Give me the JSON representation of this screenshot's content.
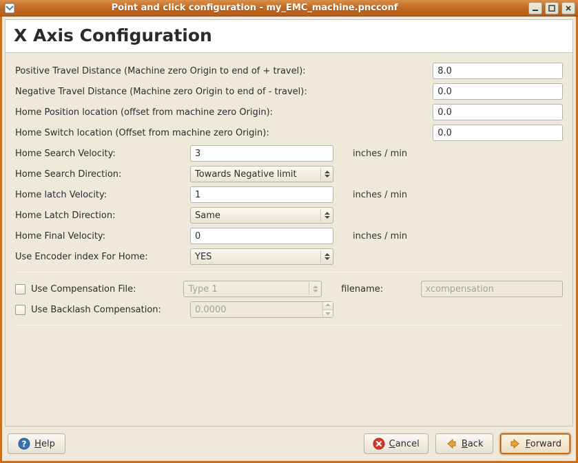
{
  "window": {
    "title": "Point and click configuration - my_EMC_machine.pncconf"
  },
  "page": {
    "title": "X Axis Configuration"
  },
  "fields": {
    "pos_travel_label": "Positive Travel Distance  (Machine zero Origin to end of + travel):",
    "pos_travel_value": "8.0",
    "neg_travel_label": "Negative Travel Distance  (Machine zero Origin to end of - travel):",
    "neg_travel_value": "0.0",
    "home_pos_label": "Home Position location   (offset from machine zero Origin):",
    "home_pos_value": "0.0",
    "home_switch_label": "Home Switch location   (Offset from machine zero Origin):",
    "home_switch_value": "0.0",
    "home_search_vel_label": "Home Search Velocity:",
    "home_search_vel_value": "3",
    "home_search_dir_label": "Home Search Direction:",
    "home_search_dir_value": "Towards Negative limit",
    "home_latch_vel_label": "Home latch Velocity:",
    "home_latch_vel_value": "1",
    "home_latch_dir_label": "Home Latch Direction:",
    "home_latch_dir_value": "Same",
    "home_final_vel_label": "Home Final Velocity:",
    "home_final_vel_value": "0",
    "use_encoder_label": "Use Encoder index For Home:",
    "use_encoder_value": "YES",
    "unit": "inches / min"
  },
  "comp": {
    "use_comp_file_label": "Use Compensation File:",
    "comp_type_value": "Type 1",
    "filename_label": "filename:",
    "filename_value": "xcompensation",
    "use_backlash_label": "Use Backlash Compensation:",
    "backlash_value": "0.0000"
  },
  "footer": {
    "help": "Help",
    "cancel": "Cancel",
    "back": "Back",
    "forward": "Forward"
  }
}
